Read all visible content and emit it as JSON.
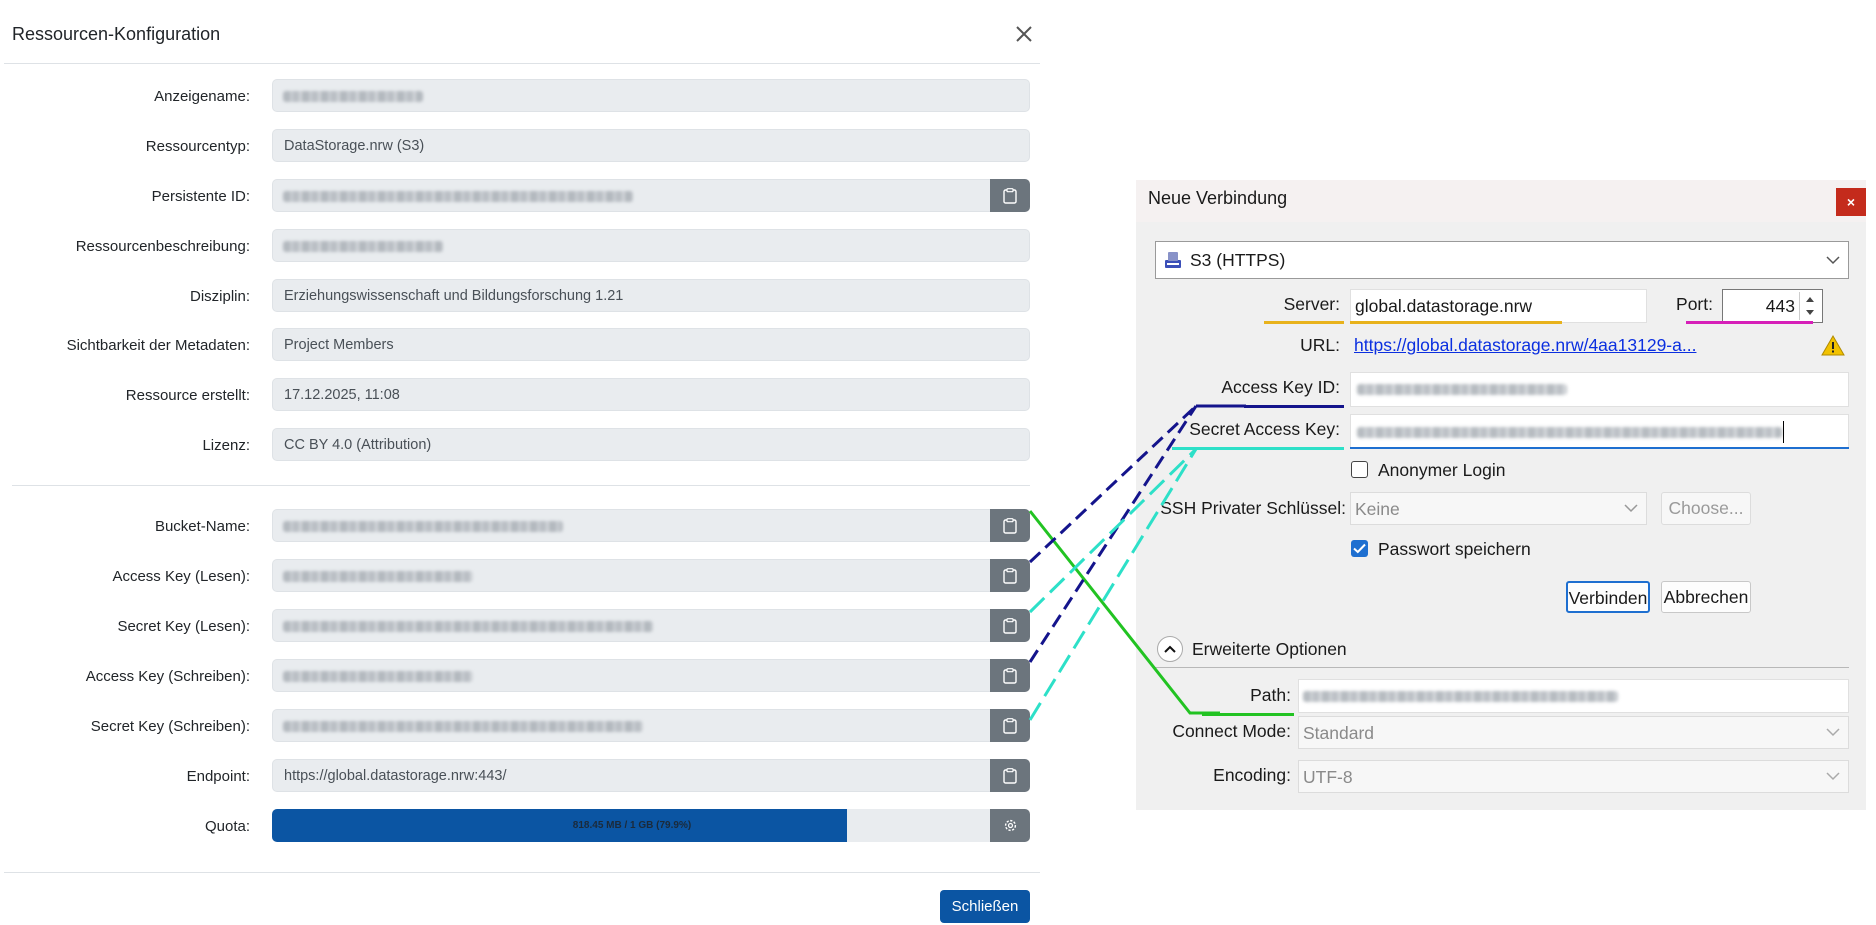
{
  "modal": {
    "title": "Ressourcen-Konfiguration",
    "fields": [
      {
        "label": "Anzeigename:",
        "value": ""
      },
      {
        "label": "Ressourcentyp:",
        "value": "DataStorage.nrw (S3)"
      },
      {
        "label": "Persistente ID:",
        "value": ""
      },
      {
        "label": "Ressourcenbeschreibung:",
        "value": ""
      },
      {
        "label": "Disziplin:",
        "value": "Erziehungswissenschaft und Bildungsforschung 1.21"
      },
      {
        "label": "Sichtbarkeit der Metadaten:",
        "value": "Project Members"
      },
      {
        "label": "Ressource erstellt:",
        "value": "17.12.2025, 11:08"
      },
      {
        "label": "Lizenz:",
        "value": "CC BY 4.0 (Attribution)"
      }
    ],
    "storage_fields": [
      {
        "label": "Bucket-Name:",
        "value": ""
      },
      {
        "label": "Access Key (Lesen):",
        "value": ""
      },
      {
        "label": "Secret Key (Lesen):",
        "value": ""
      },
      {
        "label": "Access Key (Schreiben):",
        "value": ""
      },
      {
        "label": "Secret Key (Schreiben):",
        "value": ""
      },
      {
        "label": "Endpoint:",
        "value": "https://global.datastorage.nrw:443/"
      }
    ],
    "quota": {
      "label": "Quota:",
      "text": "818.45 MB / 1 GB (79.9%)",
      "fraction": 0.799
    },
    "close_button": "Schließen"
  },
  "dialog": {
    "title": "Neue Verbindung",
    "close_label": "×",
    "protocol": "S3 (HTTPS)",
    "server_label": "Server:",
    "server_value": "global.datastorage.nrw",
    "port_label": "Port:",
    "port_value": "443",
    "url_label": "URL:",
    "url_value": "https://global.datastorage.nrw/4aa13129-a...",
    "access_key_label": "Access Key ID:",
    "secret_key_label": "Secret Access Key:",
    "anon_label": "Anonymer Login",
    "anon_checked": false,
    "ssh_label": "SSH Privater Schlüssel:",
    "ssh_value": "Keine",
    "choose_button": "Choose...",
    "save_password_label": "Passwort speichern",
    "save_password_checked": true,
    "connect_button": "Verbinden",
    "cancel_button": "Abbrechen",
    "advanced_label": "Erweiterte Optionen",
    "path_label": "Path:",
    "connect_mode_label": "Connect Mode:",
    "connect_mode_value": "Standard",
    "encoding_label": "Encoding:",
    "encoding_value": "UTF-8"
  },
  "colors": {
    "primary": "#0b55a3",
    "secondary": "#6c757d",
    "server_underline": "#e8b21c",
    "port_underline": "#d61fb8",
    "access_key_line": "#14148c",
    "secret_key_line": "#2de0c8",
    "bucket_line": "#22c322",
    "warning": "#f2c200"
  },
  "icons": [
    "close-icon",
    "clipboard-icon",
    "gear-icon",
    "s3-icon",
    "chevron-down-icon",
    "warning-icon",
    "checkmark-icon",
    "collapse-icon"
  ]
}
